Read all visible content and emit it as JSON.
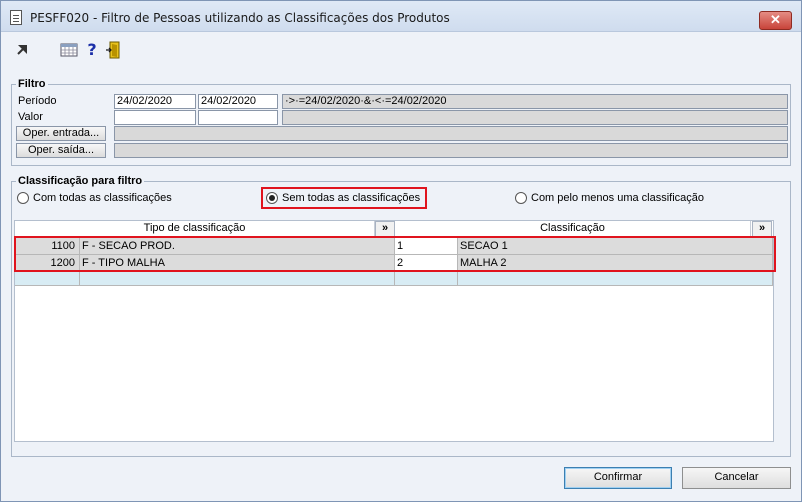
{
  "window": {
    "title": "PESFF020 - Filtro de Pessoas utilizando as Classificações dos Produtos",
    "close_label": "✕"
  },
  "toolbar": {
    "icons": [
      "arrow-icon",
      "calculator-icon",
      "help-icon",
      "exit-door-icon"
    ],
    "help_glyph": "?"
  },
  "filtro": {
    "legend": "Filtro",
    "periodo_label": "Período",
    "periodo_from": "24/02/2020",
    "periodo_to": "24/02/2020",
    "periodo_expr": "·>·=24/02/2020·&·<·=24/02/2020",
    "valor_label": "Valor",
    "valor_from": "",
    "valor_to": "",
    "valor_expr": "",
    "oper_entrada_label": "Oper. entrada...",
    "oper_entrada_value": "",
    "oper_saida_label": "Oper. saída...",
    "oper_saida_value": ""
  },
  "classificacao": {
    "legend": "Classificação para filtro",
    "options": [
      {
        "label": "Com todas as classificações",
        "checked": false
      },
      {
        "label": "Sem todas as classificações",
        "checked": true
      },
      {
        "label": "Com pelo menos uma classificação",
        "checked": false
      }
    ]
  },
  "grid": {
    "headers": {
      "tipo": "Tipo de classificação",
      "classificacao": "Classificação",
      "expand": "»"
    },
    "rows": [
      {
        "tipo_code": "1100",
        "tipo_desc": "F - SECAO PROD.",
        "class_code": "1",
        "class_desc": "SECAO 1"
      },
      {
        "tipo_code": "1200",
        "tipo_desc": "F - TIPO MALHA",
        "class_code": "2",
        "class_desc": "MALHA 2"
      }
    ]
  },
  "footer": {
    "confirmar_label": "Confirmar",
    "cancelar_label": "Cancelar"
  }
}
